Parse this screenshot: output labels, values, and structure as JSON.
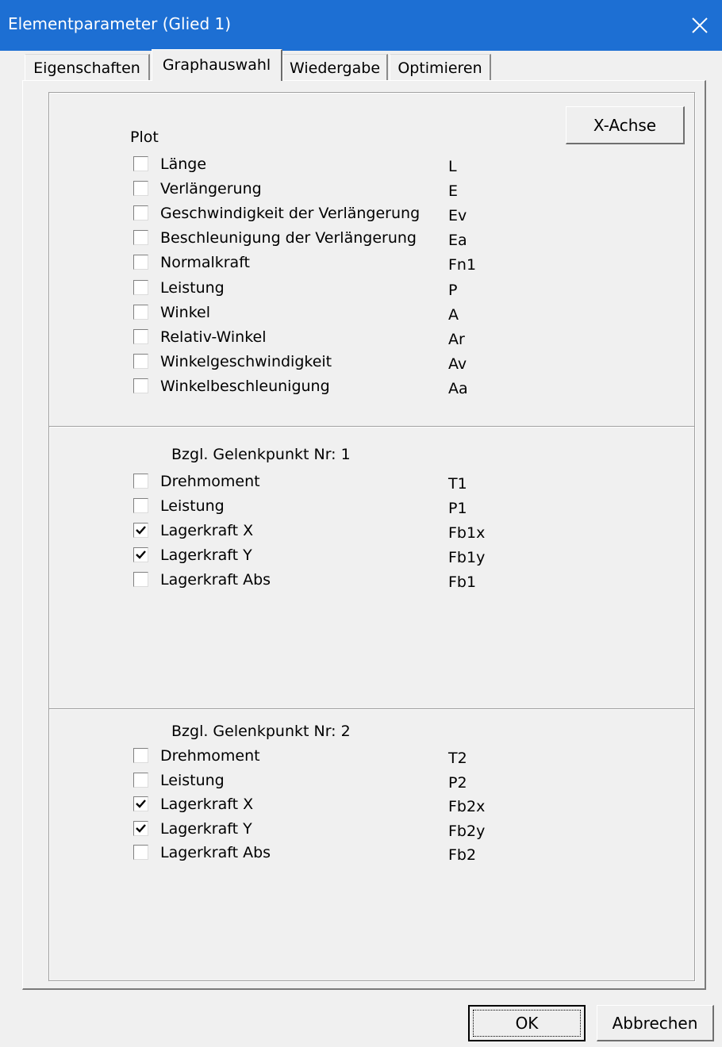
{
  "window": {
    "title": "Elementparameter (Glied 1)",
    "close_icon": "close-icon"
  },
  "tabs": [
    {
      "label": "Eigenschaften",
      "active": false
    },
    {
      "label": "Graphauswahl",
      "active": true
    },
    {
      "label": "Wiedergabe",
      "active": false
    },
    {
      "label": "Optimieren",
      "active": false
    }
  ],
  "xaxis_button": "X-Achse",
  "plot": {
    "title": "Plot",
    "items": [
      {
        "label": "Länge",
        "abbr": "L",
        "checked": false
      },
      {
        "label": "Verlängerung",
        "abbr": "E",
        "checked": false
      },
      {
        "label": "Geschwindigkeit der Verlängerung",
        "abbr": "Ev",
        "checked": false
      },
      {
        "label": "Beschleunigung der Verlängerung",
        "abbr": "Ea",
        "checked": false
      },
      {
        "label": "Normalkraft",
        "abbr": "Fn1",
        "checked": false
      },
      {
        "label": "Leistung",
        "abbr": "P",
        "checked": false
      },
      {
        "label": "Winkel",
        "abbr": "A",
        "checked": false
      },
      {
        "label": "Relativ-Winkel",
        "abbr": "Ar",
        "checked": false
      },
      {
        "label": "Winkelgeschwindigkeit",
        "abbr": "Av",
        "checked": false
      },
      {
        "label": "Winkelbeschleunigung",
        "abbr": "Aa",
        "checked": false
      }
    ]
  },
  "joint1": {
    "title": "Bzgl. Gelenkpunkt Nr: 1",
    "items": [
      {
        "label": "Drehmoment",
        "abbr": "T1",
        "checked": false
      },
      {
        "label": "Leistung",
        "abbr": "P1",
        "checked": false
      },
      {
        "label": "Lagerkraft X",
        "abbr": "Fb1x",
        "checked": true
      },
      {
        "label": "Lagerkraft Y",
        "abbr": "Fb1y",
        "checked": true
      },
      {
        "label": "Lagerkraft Abs",
        "abbr": "Fb1",
        "checked": false
      }
    ]
  },
  "joint2": {
    "title": "Bzgl. Gelenkpunkt Nr: 2",
    "items": [
      {
        "label": "Drehmoment",
        "abbr": "T2",
        "checked": false
      },
      {
        "label": "Leistung",
        "abbr": "P2",
        "checked": false
      },
      {
        "label": "Lagerkraft X",
        "abbr": "Fb2x",
        "checked": true
      },
      {
        "label": "Lagerkraft Y",
        "abbr": "Fb2y",
        "checked": true
      },
      {
        "label": "Lagerkraft Abs",
        "abbr": "Fb2",
        "checked": false
      }
    ]
  },
  "buttons": {
    "ok": "OK",
    "cancel": "Abbrechen"
  }
}
